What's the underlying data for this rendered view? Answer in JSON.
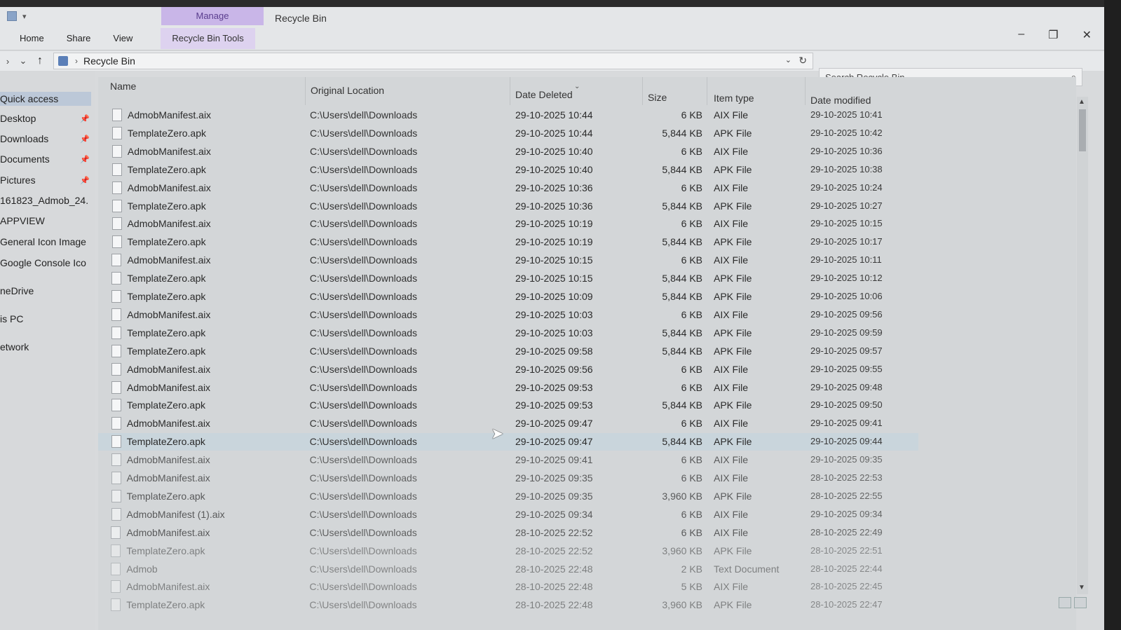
{
  "ribbon": {
    "context_group": "Manage",
    "window_title": "Recycle Bin",
    "tabs": [
      "Home",
      "Share",
      "View"
    ],
    "context_tab": "Recycle Bin Tools"
  },
  "address": {
    "crumb": "Recycle Bin",
    "search_placeholder": "Search Recycle Bin"
  },
  "nav": {
    "items": [
      {
        "label": "Quick access",
        "pinned": false,
        "selected": true
      },
      {
        "label": "Desktop",
        "pinned": true
      },
      {
        "label": "Downloads",
        "pinned": true
      },
      {
        "label": "Documents",
        "pinned": true
      },
      {
        "label": "Pictures",
        "pinned": true
      },
      {
        "label": "161823_Admob_24.",
        "pinned": false
      },
      {
        "label": "APPVIEW",
        "pinned": false
      },
      {
        "label": "General Icon Image",
        "pinned": false
      },
      {
        "label": "Google Console Ico",
        "pinned": false
      },
      {
        "label": "neDrive",
        "pinned": false
      },
      {
        "label": "is PC",
        "pinned": false
      },
      {
        "label": "etwork",
        "pinned": false
      }
    ]
  },
  "columns": {
    "name": "Name",
    "location": "Original Location",
    "deleted": "Date Deleted",
    "size": "Size",
    "type": "Item type",
    "modified": "Date modified"
  },
  "rows": [
    {
      "name": "AdmobManifest.aix",
      "loc": "C:\\Users\\dell\\Downloads",
      "deleted": "29-10-2025 10:44",
      "size": "6 KB",
      "type": "AIX File",
      "modified": "29-10-2025 10:41"
    },
    {
      "name": "TemplateZero.apk",
      "loc": "C:\\Users\\dell\\Downloads",
      "deleted": "29-10-2025 10:44",
      "size": "5,844 KB",
      "type": "APK File",
      "modified": "29-10-2025 10:42"
    },
    {
      "name": "AdmobManifest.aix",
      "loc": "C:\\Users\\dell\\Downloads",
      "deleted": "29-10-2025 10:40",
      "size": "6 KB",
      "type": "AIX File",
      "modified": "29-10-2025 10:36"
    },
    {
      "name": "TemplateZero.apk",
      "loc": "C:\\Users\\dell\\Downloads",
      "deleted": "29-10-2025 10:40",
      "size": "5,844 KB",
      "type": "APK File",
      "modified": "29-10-2025 10:38"
    },
    {
      "name": "AdmobManifest.aix",
      "loc": "C:\\Users\\dell\\Downloads",
      "deleted": "29-10-2025 10:36",
      "size": "6 KB",
      "type": "AIX File",
      "modified": "29-10-2025 10:24"
    },
    {
      "name": "TemplateZero.apk",
      "loc": "C:\\Users\\dell\\Downloads",
      "deleted": "29-10-2025 10:36",
      "size": "5,844 KB",
      "type": "APK File",
      "modified": "29-10-2025 10:27"
    },
    {
      "name": "AdmobManifest.aix",
      "loc": "C:\\Users\\dell\\Downloads",
      "deleted": "29-10-2025 10:19",
      "size": "6 KB",
      "type": "AIX File",
      "modified": "29-10-2025 10:15"
    },
    {
      "name": "TemplateZero.apk",
      "loc": "C:\\Users\\dell\\Downloads",
      "deleted": "29-10-2025 10:19",
      "size": "5,844 KB",
      "type": "APK File",
      "modified": "29-10-2025 10:17"
    },
    {
      "name": "AdmobManifest.aix",
      "loc": "C:\\Users\\dell\\Downloads",
      "deleted": "29-10-2025 10:15",
      "size": "6 KB",
      "type": "AIX File",
      "modified": "29-10-2025 10:11"
    },
    {
      "name": "TemplateZero.apk",
      "loc": "C:\\Users\\dell\\Downloads",
      "deleted": "29-10-2025 10:15",
      "size": "5,844 KB",
      "type": "APK File",
      "modified": "29-10-2025 10:12"
    },
    {
      "name": "TemplateZero.apk",
      "loc": "C:\\Users\\dell\\Downloads",
      "deleted": "29-10-2025 10:09",
      "size": "5,844 KB",
      "type": "APK File",
      "modified": "29-10-2025 10:06"
    },
    {
      "name": "AdmobManifest.aix",
      "loc": "C:\\Users\\dell\\Downloads",
      "deleted": "29-10-2025 10:03",
      "size": "6 KB",
      "type": "AIX File",
      "modified": "29-10-2025 09:56"
    },
    {
      "name": "TemplateZero.apk",
      "loc": "C:\\Users\\dell\\Downloads",
      "deleted": "29-10-2025 10:03",
      "size": "5,844 KB",
      "type": "APK File",
      "modified": "29-10-2025 09:59"
    },
    {
      "name": "TemplateZero.apk",
      "loc": "C:\\Users\\dell\\Downloads",
      "deleted": "29-10-2025 09:58",
      "size": "5,844 KB",
      "type": "APK File",
      "modified": "29-10-2025 09:57"
    },
    {
      "name": "AdmobManifest.aix",
      "loc": "C:\\Users\\dell\\Downloads",
      "deleted": "29-10-2025 09:56",
      "size": "6 KB",
      "type": "AIX File",
      "modified": "29-10-2025 09:55"
    },
    {
      "name": "AdmobManifest.aix",
      "loc": "C:\\Users\\dell\\Downloads",
      "deleted": "29-10-2025 09:53",
      "size": "6 KB",
      "type": "AIX File",
      "modified": "29-10-2025 09:48"
    },
    {
      "name": "TemplateZero.apk",
      "loc": "C:\\Users\\dell\\Downloads",
      "deleted": "29-10-2025 09:53",
      "size": "5,844 KB",
      "type": "APK File",
      "modified": "29-10-2025 09:50"
    },
    {
      "name": "AdmobManifest.aix",
      "loc": "C:\\Users\\dell\\Downloads",
      "deleted": "29-10-2025 09:47",
      "size": "6 KB",
      "type": "AIX File",
      "modified": "29-10-2025 09:41"
    },
    {
      "name": "TemplateZero.apk",
      "loc": "C:\\Users\\dell\\Downloads",
      "deleted": "29-10-2025 09:47",
      "size": "5,844 KB",
      "type": "APK File",
      "modified": "29-10-2025 09:44",
      "selected": true
    },
    {
      "name": "AdmobManifest.aix",
      "loc": "C:\\Users\\dell\\Downloads",
      "deleted": "29-10-2025 09:41",
      "size": "6 KB",
      "type": "AIX File",
      "modified": "29-10-2025 09:35"
    },
    {
      "name": "AdmobManifest.aix",
      "loc": "C:\\Users\\dell\\Downloads",
      "deleted": "29-10-2025 09:35",
      "size": "6 KB",
      "type": "AIX File",
      "modified": "28-10-2025 22:53"
    },
    {
      "name": "TemplateZero.apk",
      "loc": "C:\\Users\\dell\\Downloads",
      "deleted": "29-10-2025 09:35",
      "size": "3,960 KB",
      "type": "APK File",
      "modified": "28-10-2025 22:55"
    },
    {
      "name": "AdmobManifest (1).aix",
      "loc": "C:\\Users\\dell\\Downloads",
      "deleted": "29-10-2025 09:34",
      "size": "6 KB",
      "type": "AIX File",
      "modified": "29-10-2025 09:34"
    },
    {
      "name": "AdmobManifest.aix",
      "loc": "C:\\Users\\dell\\Downloads",
      "deleted": "28-10-2025 22:52",
      "size": "6 KB",
      "type": "AIX File",
      "modified": "28-10-2025 22:49"
    },
    {
      "name": "TemplateZero.apk",
      "loc": "C:\\Users\\dell\\Downloads",
      "deleted": "28-10-2025 22:52",
      "size": "3,960 KB",
      "type": "APK File",
      "modified": "28-10-2025 22:51"
    },
    {
      "name": "Admob",
      "loc": "C:\\Users\\dell\\Downloads",
      "deleted": "28-10-2025 22:48",
      "size": "2 KB",
      "type": "Text Document",
      "modified": "28-10-2025 22:44"
    },
    {
      "name": "AdmobManifest.aix",
      "loc": "C:\\Users\\dell\\Downloads",
      "deleted": "28-10-2025 22:48",
      "size": "5 KB",
      "type": "AIX File",
      "modified": "28-10-2025 22:45"
    },
    {
      "name": "TemplateZero.apk",
      "loc": "C:\\Users\\dell\\Downloads",
      "deleted": "28-10-2025 22:48",
      "size": "3,960 KB",
      "type": "APK File",
      "modified": "28-10-2025 22:47"
    }
  ]
}
